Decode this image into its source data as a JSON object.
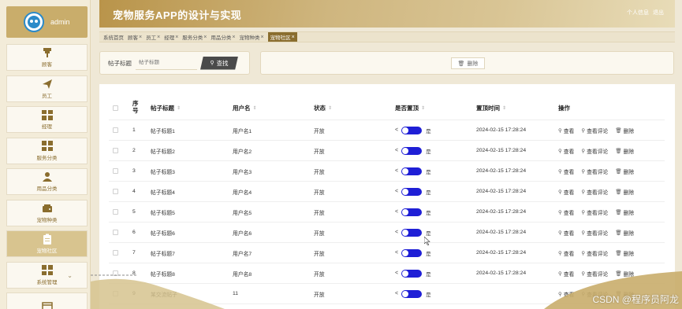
{
  "sidebar": {
    "user": {
      "name": "admin"
    },
    "items": [
      {
        "label": "顾客",
        "icon": "pin-icon"
      },
      {
        "label": "员工",
        "icon": "paper-plane-icon"
      },
      {
        "label": "经理",
        "icon": "grid-icon"
      },
      {
        "label": "服务分类",
        "icon": "grid-icon"
      },
      {
        "label": "用品分类",
        "icon": "person-icon"
      },
      {
        "label": "宠物种类",
        "icon": "wallet-icon"
      },
      {
        "label": "宠物社区",
        "icon": "clipboard-icon",
        "active": true
      },
      {
        "label": "系统管理",
        "icon": "grid-icon"
      }
    ]
  },
  "header": {
    "title": "宠物服务APP的设计与实现",
    "user_info": "个人信息",
    "logout": "退出"
  },
  "tags": [
    {
      "label": "系统首页",
      "closable": false
    },
    {
      "label": "顾客",
      "closable": true
    },
    {
      "label": "员工",
      "closable": true
    },
    {
      "label": "经理",
      "closable": true
    },
    {
      "label": "服务分类",
      "closable": true
    },
    {
      "label": "用品分类",
      "closable": true
    },
    {
      "label": "宠物种类",
      "closable": true
    },
    {
      "label": "宠物社区",
      "closable": true,
      "active": true
    }
  ],
  "search": {
    "label": "帖子标题",
    "placeholder": "帖子标题",
    "button": "查找"
  },
  "actions": {
    "delete": "删除"
  },
  "table": {
    "headers": {
      "idx_a": "序",
      "idx_b": "号",
      "title": "帖子标题",
      "user": "用户名",
      "status": "状态",
      "top": "是否置顶",
      "time": "置顶时间",
      "ops": "操作"
    },
    "op_labels": {
      "view": "查看",
      "view_comments": "查看评论",
      "delete": "删除"
    },
    "top_flag": "是",
    "rows": [
      {
        "idx": "1",
        "title": "帖子标题1",
        "user": "用户名1",
        "status": "开放",
        "time": "2024-02-15 17:28:24"
      },
      {
        "idx": "2",
        "title": "帖子标题2",
        "user": "用户名2",
        "status": "开放",
        "time": "2024-02-15 17:28:24"
      },
      {
        "idx": "3",
        "title": "帖子标题3",
        "user": "用户名3",
        "status": "开放",
        "time": "2024-02-15 17:28:24"
      },
      {
        "idx": "4",
        "title": "帖子标题4",
        "user": "用户名4",
        "status": "开放",
        "time": "2024-02-15 17:28:24"
      },
      {
        "idx": "5",
        "title": "帖子标题5",
        "user": "用户名5",
        "status": "开放",
        "time": "2024-02-15 17:28:24"
      },
      {
        "idx": "6",
        "title": "帖子标题6",
        "user": "用户名6",
        "status": "开放",
        "time": "2024-02-15 17:28:24"
      },
      {
        "idx": "7",
        "title": "帖子标题7",
        "user": "用户名7",
        "status": "开放",
        "time": "2024-02-15 17:28:24"
      },
      {
        "idx": "8",
        "title": "帖子标题8",
        "user": "用户名8",
        "status": "开放",
        "time": "2024-02-15 17:28:24"
      },
      {
        "idx": "9",
        "title": "某交流帖子",
        "user": "11",
        "status": "开放",
        "time": ""
      }
    ]
  },
  "watermark": "CSDN @程序员阿龙",
  "colors": {
    "accent": "#c9ad6b",
    "toggle": "#1f1fd6",
    "header": "#b9944a"
  }
}
